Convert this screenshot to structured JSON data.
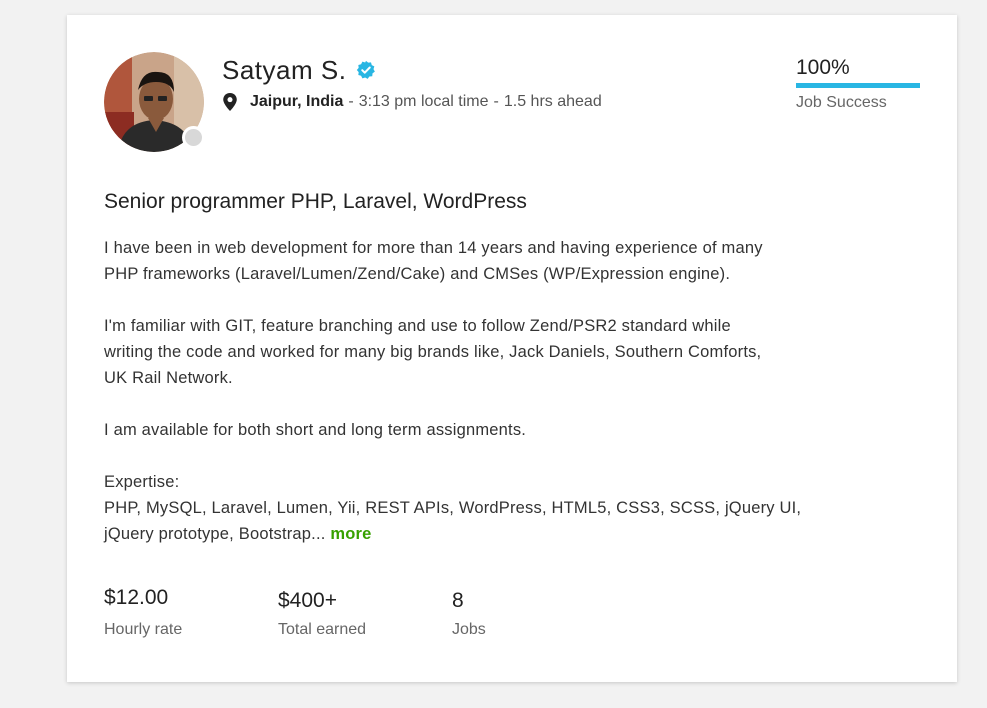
{
  "profile": {
    "name": "Satyam S.",
    "city": "Jaipur, India",
    "local_time": "3:13 pm local time",
    "time_offset": "1.5 hrs ahead",
    "separator": "-"
  },
  "job_success": {
    "value": "100%",
    "percent": 100,
    "label": "Job Success",
    "bar_color": "#29b6e3"
  },
  "overview": {
    "title": "Senior programmer PHP, Laravel, WordPress",
    "para1_line1": "I have been in web development for more than 14 years and having experience of many",
    "para1_line2": "PHP frameworks (Laravel/Lumen/Zend/Cake) and CMSes (WP/Expression engine).",
    "para2_line1": "I'm familiar with GIT, feature branching and use to follow Zend/PSR2 standard while",
    "para2_line2": "writing the code and worked for many big brands like, Jack Daniels, Southern Comforts,",
    "para2_line3": "UK Rail Network.",
    "para3": "I am available for both short and long term assignments.",
    "expertise_heading": "Expertise:",
    "expertise_line1": "PHP, MySQL, Laravel, Lumen, Yii, REST APIs, WordPress, HTML5, CSS3, SCSS, jQuery UI,",
    "expertise_line2": "jQuery prototype, Bootstrap...",
    "more_link": "more",
    "more_color": "#37a000"
  },
  "stats": [
    {
      "value": "$12.00",
      "label": "Hourly rate"
    },
    {
      "value": "$400+",
      "label": "Total earned"
    },
    {
      "value": "8",
      "label": "Jobs"
    }
  ],
  "icons": {
    "verified": "verified-badge-icon",
    "location": "location-pin-icon"
  }
}
